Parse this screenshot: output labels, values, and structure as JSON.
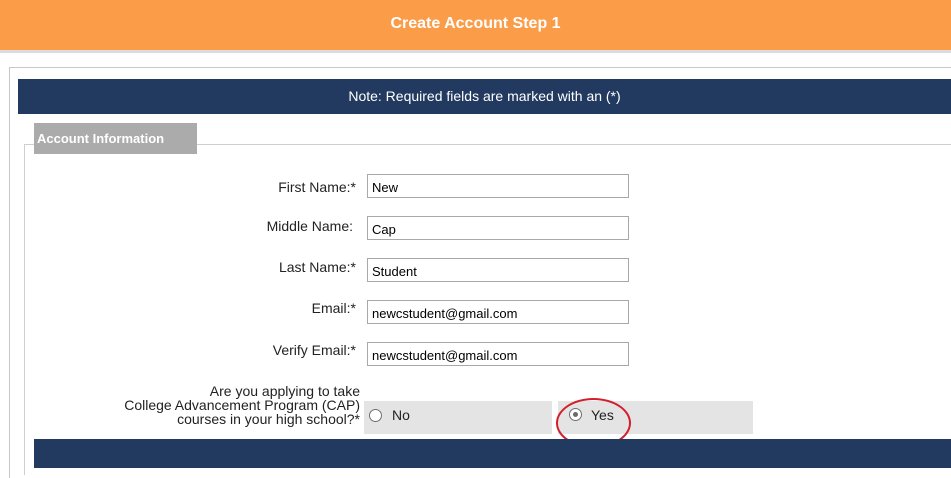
{
  "header": {
    "title": "Create Account Step 1"
  },
  "note": {
    "text": "Note: Required fields are marked with an (*)"
  },
  "section": {
    "legend": "Account Information"
  },
  "fields": {
    "first_name": {
      "label": "First Name:*",
      "value": "New"
    },
    "middle_name": {
      "label": "Middle Name:",
      "value": "Cap"
    },
    "last_name": {
      "label": "Last Name:*",
      "value": "Student"
    },
    "email": {
      "label": "Email:*",
      "value": "newcstudent@gmail.com"
    },
    "verify_email": {
      "label": "Verify Email:*",
      "value": "newcstudent@gmail.com"
    }
  },
  "cap_question": {
    "line1": "Are you applying to take",
    "line2": "College Advancement Program (CAP)",
    "line3": "courses in your high school?*",
    "options": {
      "no": {
        "label": "No",
        "selected": false
      },
      "yes": {
        "label": "Yes",
        "selected": true
      }
    }
  },
  "colors": {
    "header": "#fb9c48",
    "navy": "#223a60",
    "legend": "#ababab",
    "highlight": "#d21f2b"
  }
}
